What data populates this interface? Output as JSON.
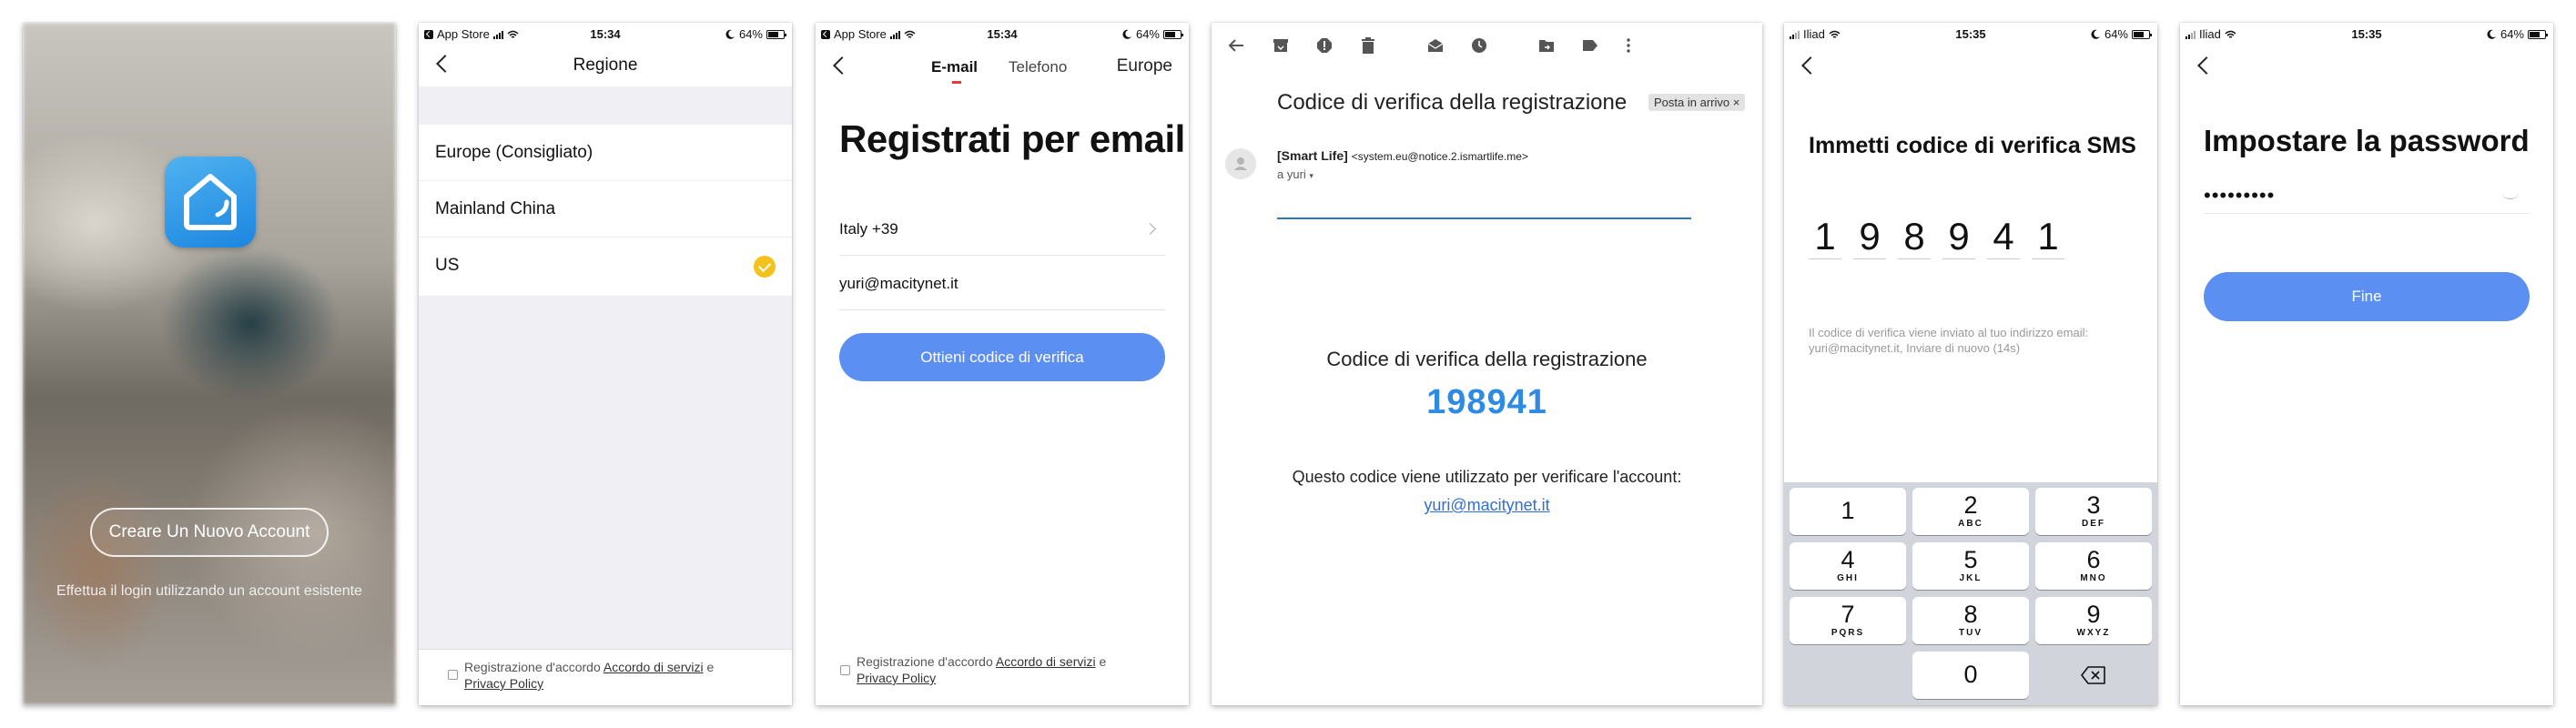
{
  "status": {
    "time_1": "15:34",
    "time_2": "15:35",
    "carrier_back": "App Store",
    "carrier_iliad": "Iliad",
    "battery": "64%"
  },
  "welcome": {
    "create_account": "Creare Un Nuovo Account",
    "login_existing": "Effettua il login utilizzando un account esistente"
  },
  "region": {
    "title": "Regione",
    "items": [
      {
        "label": "Europe (Consigliato)",
        "selected": false
      },
      {
        "label": "Mainland China",
        "selected": false
      },
      {
        "label": "US",
        "selected": true
      }
    ],
    "consent_prefix": "Registrazione d'accordo",
    "consent_terms": "Accordo di servizi",
    "consent_and": "e",
    "consent_privacy": "Privacy Policy"
  },
  "register": {
    "tab_email": "E-mail",
    "tab_phone": "Telefono",
    "region_link": "Europe",
    "title": "Registrati per email",
    "country_value": "Italy +39",
    "email_value": "yuri@macitynet.it",
    "submit": "Ottieni codice di verifica",
    "consent_prefix": "Registrazione d'accordo",
    "consent_terms": "Accordo di servizi",
    "consent_and": "e",
    "consent_privacy": "Privacy Policy"
  },
  "email": {
    "subject": "Codice di verifica della registrazione",
    "label_chip": "Posta in arrivo ×",
    "sender_name": "[Smart Life]",
    "sender_address": "<system.eu@notice.2.ismartlife.me>",
    "to": "a yuri",
    "heading": "Codice di verifica della registrazione",
    "code": "198941",
    "purpose": "Questo codice viene utilizzato per verificare l'account:",
    "account_link": "yuri@macitynet.it"
  },
  "sms": {
    "title": "Immetti codice di verifica SMS",
    "digits": [
      "1",
      "9",
      "8",
      "9",
      "4",
      "1"
    ],
    "hint": "Il codice di verifica viene inviato al tuo indirizzo email: yuri@macitynet.it, Inviare di nuovo (14s)",
    "keys": [
      {
        "n": "1",
        "l": ""
      },
      {
        "n": "2",
        "l": "ABC"
      },
      {
        "n": "3",
        "l": "DEF"
      },
      {
        "n": "4",
        "l": "GHI"
      },
      {
        "n": "5",
        "l": "JKL"
      },
      {
        "n": "6",
        "l": "MNO"
      },
      {
        "n": "7",
        "l": "PQRS"
      },
      {
        "n": "8",
        "l": "TUV"
      },
      {
        "n": "9",
        "l": "WXYZ"
      },
      {
        "n": "0",
        "l": ""
      }
    ]
  },
  "password": {
    "title": "Impostare la password",
    "masked_value": "•••••••••",
    "submit": "Fine"
  },
  "colors": {
    "accent_blue": "#5b8ff2",
    "code_blue": "#2f8ae5",
    "check_yellow": "#f5c21b",
    "tab_red": "#e53935"
  }
}
